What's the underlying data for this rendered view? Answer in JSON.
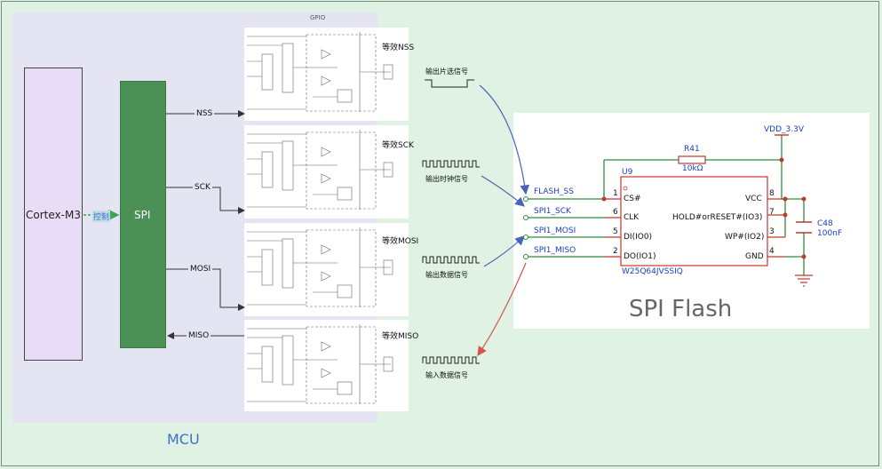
{
  "mcu": {
    "label": "MCU",
    "gpio_label": "GPIO"
  },
  "cortex": {
    "label": "Cortex-M3"
  },
  "spi": {
    "label": "SPI",
    "control_label": "控制"
  },
  "signals": {
    "nss": "NSS",
    "sck": "SCK",
    "mosi": "MOSI",
    "miso": "MISO"
  },
  "gpio_panels": [
    {
      "equiv": "等效NSS",
      "desc": "输出片选信号"
    },
    {
      "equiv": "等效SCK",
      "desc": "输出时钟信号"
    },
    {
      "equiv": "等效MOSI",
      "desc": "输出数据信号"
    },
    {
      "equiv": "等效MISO",
      "desc": "输入数据信号"
    }
  ],
  "schematic": {
    "title": "SPI Flash",
    "vdd": "VDD_3.3V",
    "resistor": {
      "ref": "R41",
      "value": "10kΩ"
    },
    "capacitor": {
      "ref": "C48",
      "value": "100nF"
    },
    "chip": {
      "ref": "U9",
      "part": "W25Q64JVSSIQ"
    },
    "nets": [
      "FLASH_SS",
      "SPI1_SCK",
      "SPI1_MOSI",
      "SPI1_MISO"
    ],
    "left_pins": [
      {
        "num": "1",
        "name": "CS#"
      },
      {
        "num": "6",
        "name": "CLK"
      },
      {
        "num": "5",
        "name": "DI(IO0)"
      },
      {
        "num": "2",
        "name": "DO(IO1)"
      }
    ],
    "right_pins": [
      {
        "num": "8",
        "name": "VCC"
      },
      {
        "num": "7",
        "name": "HOLD#orRESET#(IO3)"
      },
      {
        "num": "3",
        "name": "WP#(IO2)"
      },
      {
        "num": "4",
        "name": "GND"
      }
    ]
  }
}
